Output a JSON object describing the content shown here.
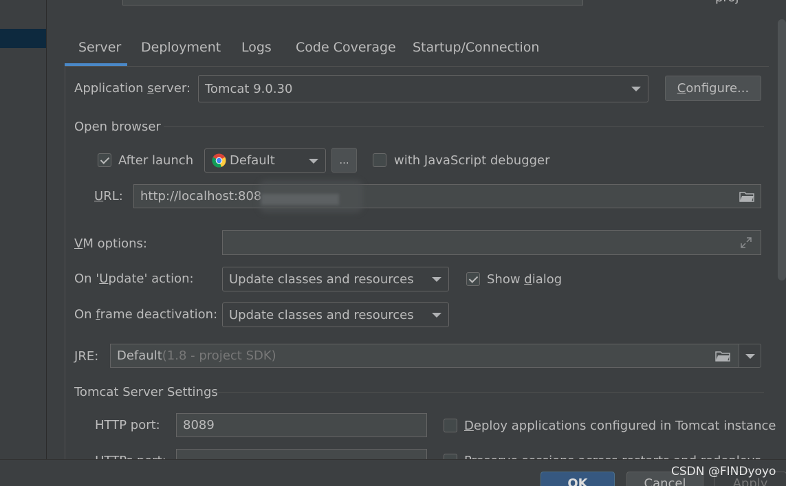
{
  "top": {
    "truncated_text": "proj"
  },
  "tabs": [
    {
      "label": "Server"
    },
    {
      "label": "Deployment"
    },
    {
      "label": "Logs"
    },
    {
      "label": "Code Coverage"
    },
    {
      "label": "Startup/Connection"
    }
  ],
  "server": {
    "app_server_label_pre": "Application ",
    "app_server_label_u": "s",
    "app_server_label_post": "erver:",
    "app_server_value": "Tomcat 9.0.30",
    "configure_pre": "",
    "configure_u": "C",
    "configure_post": "onfigure..."
  },
  "open_browser": {
    "section_title": "Open browser",
    "after_launch_label": "After launch",
    "after_launch_checked": true,
    "browser_value": "Default",
    "more_button": "...",
    "js_debugger_pre": "with ",
    "js_debugger_u": "J",
    "js_debugger_post": "avaScript debugger",
    "js_debugger_checked": false,
    "url_label_u": "U",
    "url_label_post": "RL:",
    "url_value": "http://localhost:808"
  },
  "vm": {
    "label_u": "V",
    "label_post": "M options:",
    "value": ""
  },
  "update_action": {
    "label_pre": "On '",
    "label_u": "U",
    "label_post": "pdate' action:",
    "value": "Update classes and resources",
    "show_dialog_pre": "Show ",
    "show_dialog_u": "d",
    "show_dialog_post": "ialog",
    "show_dialog_checked": true
  },
  "frame_deactivation": {
    "label_pre": "On ",
    "label_u": "f",
    "label_post": "rame deactivation:",
    "value": "Update classes and resources"
  },
  "jre": {
    "label_u": "J",
    "label_post": "RE:",
    "value": "Default",
    "hint": " (1.8 - project SDK)"
  },
  "tomcat": {
    "section_title": "Tomcat Server Settings",
    "http_port_label": "HTTP port:",
    "http_port_value": "8089",
    "deploy_pre": "",
    "deploy_u": "D",
    "deploy_post": "eploy applications configured in Tomcat instance",
    "deploy_checked": false,
    "https_port_label": "HTTPs port:",
    "preserve_label": "Preserve sessions across restarts and redeploys"
  },
  "footer": {
    "ok": "OK",
    "cancel": "Cancel",
    "apply": "Apply",
    "watermark": "CSDN @FINDyoyo"
  },
  "colors": {
    "background": "#3c3f41",
    "accent": "#4a88c7",
    "ok_button": "#365880",
    "text": "#bbbbbb"
  }
}
